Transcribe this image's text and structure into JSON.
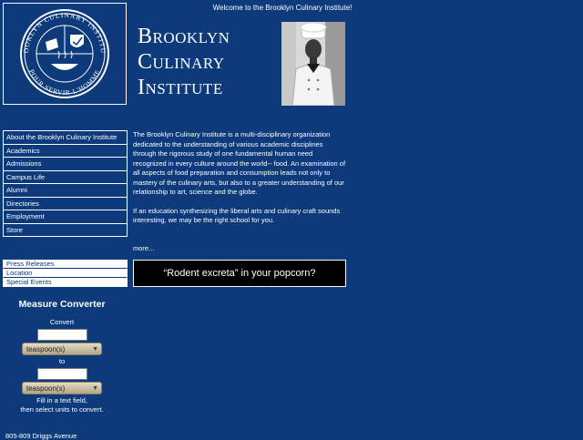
{
  "header": {
    "welcome": "Welcome to the Brooklyn Culinary Institute!",
    "brand_line1": "Brooklyn",
    "brand_line2": "Culinary",
    "brand_line3": "Institute",
    "seal_top_text": "BROOKLYN CULINARY INSTITUTE",
    "seal_bottom_text": "POUR SERVIR L'HOMME"
  },
  "main_nav": {
    "items": [
      "About the Brooklyn Culinary Institute",
      "Academics",
      "Admissions",
      "Campus Life",
      "Alumni",
      "Directories",
      "Employment",
      "Store"
    ]
  },
  "sub_nav": {
    "items": [
      "Press Releases",
      "Location",
      "Special Events"
    ]
  },
  "converter": {
    "title": "Measure Converter",
    "convert_label": "Convert",
    "from_value": "",
    "from_unit": "teaspoon(s)",
    "to_label": "to",
    "to_value": "",
    "to_unit": "teaspoon(s)",
    "help_line1": "Fill in a text field,",
    "help_line2": "then select units to convert."
  },
  "footer": {
    "address": "805-809 Driggs Avenue"
  },
  "content": {
    "paragraph1": "The Brooklyn Culinary Institute is a multi-disciplinary organization dedicated to the understanding of various academic disciplines through the rigorous study of one fundamental human need recognized in every culture around the world-- food.  An examination of all aspects of food preparation and consumption leads not only to mastery of the culinary arts, but also to a greater understanding of our relationship to art, science and the globe.",
    "paragraph2": "If an education synthesizing the liberal arts and culinary craft sounds interesting, we may be the right school for you.",
    "more_link": "more...",
    "promo": "“Rodent excreta” in your popcorn?"
  },
  "colors": {
    "background": "#0c3a7a",
    "text": "#ffffff",
    "promo_bg": "#000000"
  },
  "icons": {
    "seal": "institute-seal-icon",
    "photo": "chef-photo",
    "dropdown": "chevron-down-icon"
  }
}
